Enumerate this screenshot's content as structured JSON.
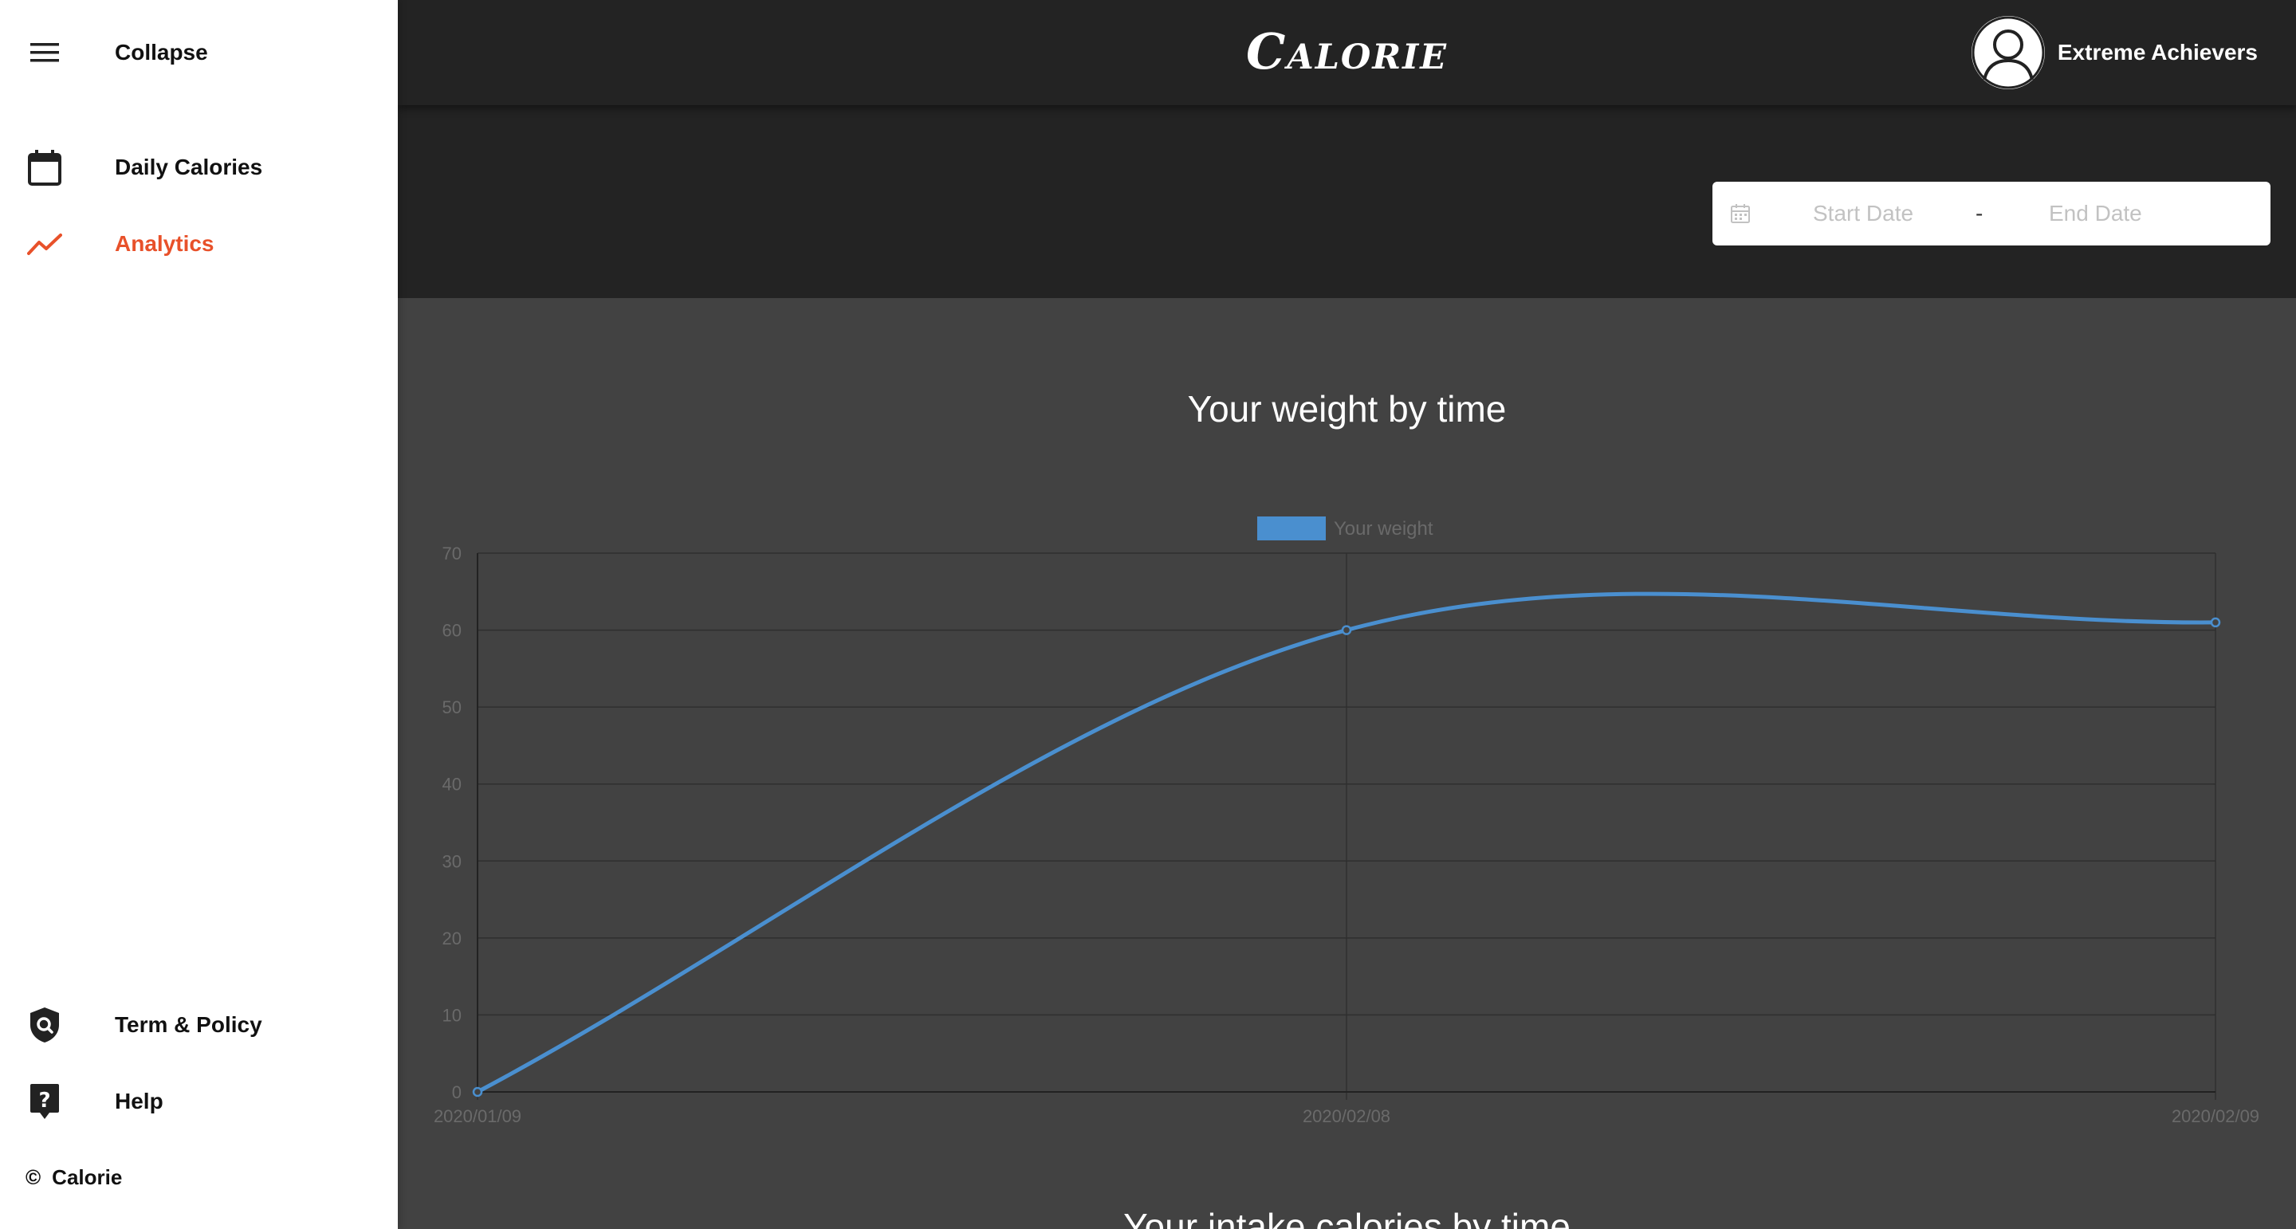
{
  "sidebar": {
    "collapse_label": "Collapse",
    "items": [
      {
        "label": "Daily Calories",
        "icon": "calendar-icon",
        "active": false
      },
      {
        "label": "Analytics",
        "icon": "trending-up-icon",
        "active": true
      }
    ],
    "bottom_items": [
      {
        "label": "Term & Policy",
        "icon": "shield-search-icon"
      },
      {
        "label": "Help",
        "icon": "help-icon"
      }
    ],
    "footer": {
      "symbol": "©",
      "label": "Calorie"
    }
  },
  "header": {
    "brand": "Calorie",
    "user_name": "Extreme Achievers"
  },
  "filters": {
    "start_placeholder": "Start Date",
    "separator": "-",
    "end_placeholder": "End Date"
  },
  "main": {
    "chart_title": "Your weight by time",
    "next_chart_title": "Your intake calories by time"
  },
  "colors": {
    "accent": "#e8512a",
    "series": "#4a8fcf",
    "header_bg": "#232323",
    "content_bg": "#424242"
  },
  "chart_data": {
    "type": "line",
    "title": "Your weight by time",
    "x": [
      "2020/01/09",
      "2020/02/08",
      "2020/02/09"
    ],
    "series": [
      {
        "name": "Your weight",
        "values": [
          0,
          60,
          61
        ]
      }
    ],
    "ylim": [
      0,
      70
    ],
    "yticks": [
      0,
      10,
      20,
      30,
      40,
      50,
      60,
      70
    ],
    "grid": true,
    "legend": "top-center",
    "smooth": true
  }
}
